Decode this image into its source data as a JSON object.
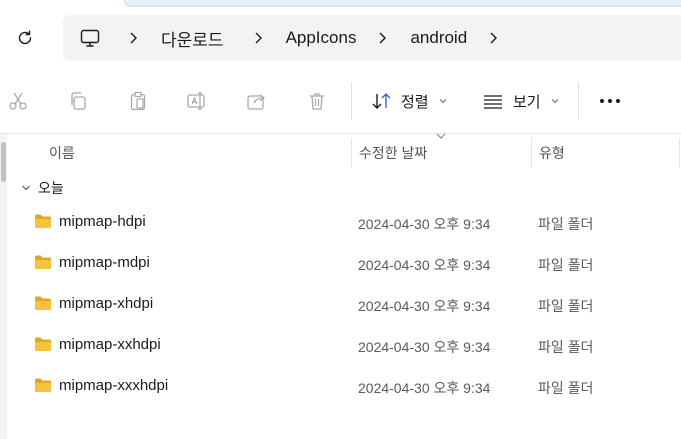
{
  "address": {
    "crumbs": [
      "다운로드",
      "AppIcons",
      "android"
    ]
  },
  "toolbar": {
    "sort_label": "정렬",
    "view_label": "보기"
  },
  "columns": {
    "name": "이름",
    "date": "수정한 날짜",
    "type": "유형"
  },
  "group": {
    "label": "오늘"
  },
  "files": [
    {
      "name": "mipmap-hdpi",
      "date": "2024-04-30 오후 9:34",
      "type": "파일 폴더"
    },
    {
      "name": "mipmap-mdpi",
      "date": "2024-04-30 오후 9:34",
      "type": "파일 폴더"
    },
    {
      "name": "mipmap-xhdpi",
      "date": "2024-04-30 오후 9:34",
      "type": "파일 폴더"
    },
    {
      "name": "mipmap-xxhdpi",
      "date": "2024-04-30 오후 9:34",
      "type": "파일 폴더"
    },
    {
      "name": "mipmap-xxxhdpi",
      "date": "2024-04-30 오후 9:34",
      "type": "파일 폴더"
    }
  ],
  "colors": {
    "folder": "#f5c33b",
    "folder_dark": "#e0a820",
    "address_bg": "#f3f3f3",
    "disabled_icon": "#a8a8a8"
  }
}
